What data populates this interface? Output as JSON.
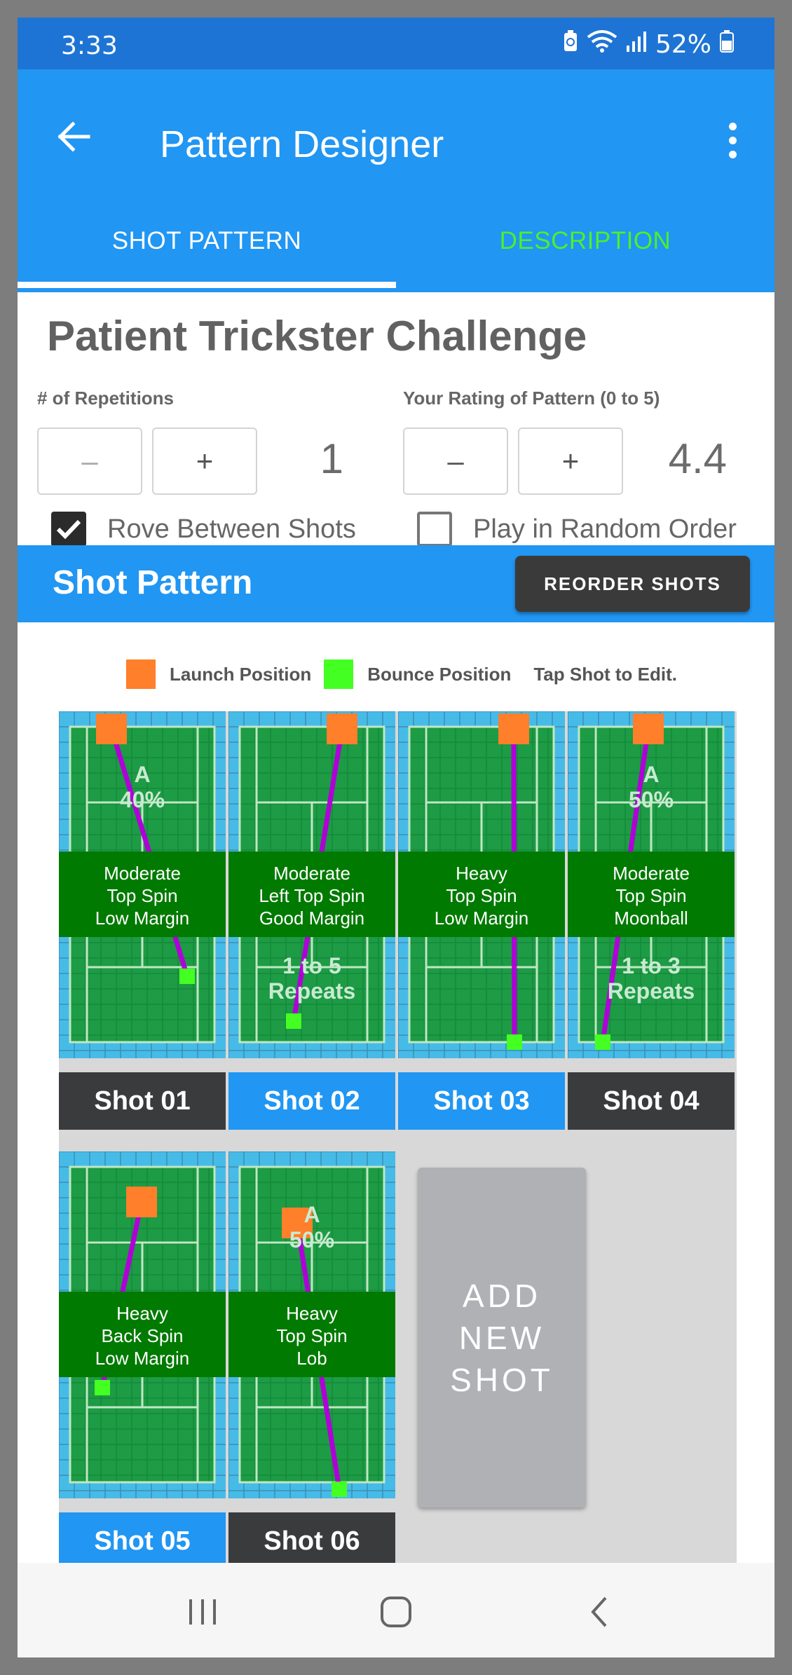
{
  "status": {
    "time": "3:33",
    "battery": "52%"
  },
  "appbar": {
    "title": "Pattern Designer"
  },
  "tabs": [
    {
      "label": "SHOT PATTERN",
      "selected": true
    },
    {
      "label": "DESCRIPTION",
      "selected": false
    }
  ],
  "pattern": {
    "title": "Patient Trickster Challenge",
    "repetitions_label": "# of Repetitions",
    "repetitions_value": "1",
    "rating_label": "Your Rating of Pattern (0 to 5)",
    "rating_value": "4.4",
    "minus": "–",
    "plus": "+",
    "rove_label": "Rove Between Shots",
    "rove_checked": true,
    "random_label": "Play in Random Order",
    "random_checked": false
  },
  "shot_pattern": {
    "title": "Shot Pattern",
    "reorder_label": "REORDER SHOTS",
    "legend": {
      "launch": "Launch Position",
      "bounce": "Bounce Position",
      "hint": "Tap Shot to Edit."
    },
    "colors": {
      "launch": "#ff7f2a",
      "bounce": "#44ff22",
      "trajectory": "#b000d8",
      "court": "#1d9b45"
    },
    "shots": [
      {
        "label": "Shot 01",
        "style": "dark",
        "desc": [
          "Moderate",
          "Top Spin",
          "Low Margin"
        ],
        "top_overlay": [
          "A",
          "40%"
        ],
        "bottom_overlay": []
      },
      {
        "label": "Shot 02",
        "style": "blue",
        "desc": [
          "Moderate",
          "Left Top Spin",
          "Good Margin"
        ],
        "top_overlay": [],
        "bottom_overlay": [
          "1 to 5",
          "Repeats"
        ]
      },
      {
        "label": "Shot 03",
        "style": "blue",
        "desc": [
          "Heavy",
          "Top Spin",
          "Low Margin"
        ],
        "top_overlay": [],
        "bottom_overlay": []
      },
      {
        "label": "Shot 04",
        "style": "dark",
        "desc": [
          "Moderate",
          "Top Spin",
          "Moonball"
        ],
        "top_overlay": [
          "A",
          "50%"
        ],
        "bottom_overlay": [
          "1 to 3",
          "Repeats"
        ]
      },
      {
        "label": "Shot 05",
        "style": "blue",
        "desc": [
          "Heavy",
          "Back Spin",
          "Low Margin"
        ],
        "top_overlay": [],
        "bottom_overlay": []
      },
      {
        "label": "Shot 06",
        "style": "dark",
        "desc": [
          "Heavy",
          "Top Spin",
          "Lob"
        ],
        "top_overlay": [
          "A",
          "50%"
        ],
        "bottom_overlay": []
      }
    ],
    "add_new_lines": [
      "ADD",
      "NEW",
      "SHOT"
    ]
  },
  "icons": {
    "back": "arrow-left-icon",
    "overflow": "more-vert-icon",
    "nav_recents": "recents-icon",
    "nav_home": "home-icon",
    "nav_back": "chevron-left-icon"
  }
}
